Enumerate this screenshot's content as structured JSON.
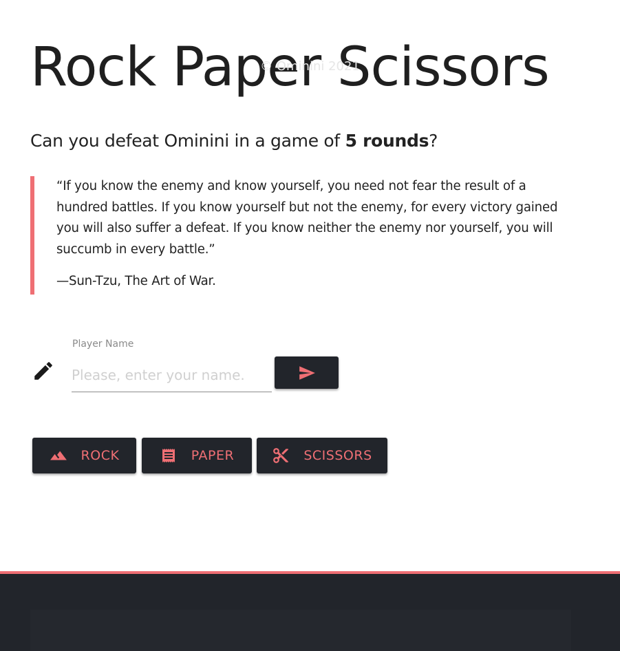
{
  "header": {
    "title": "Rock Paper Scissors",
    "subtitle_prefix": "Can you defeat Ominini in a game of ",
    "subtitle_bold": "5 rounds",
    "subtitle_suffix": "?"
  },
  "quote": {
    "text": "“If you know the enemy and know yourself, you need not fear the result of a hundred battles. If you know yourself but not the enemy, for every victory gained you will also suffer a defeat. If you know neither the enemy nor yourself, you will succumb in every battle.”",
    "author": "—Sun-Tzu, The Art of War."
  },
  "player": {
    "label": "Player Name",
    "placeholder": "Please, enter your name.",
    "value": ""
  },
  "choices": {
    "rock": "ROCK",
    "paper": "PAPER",
    "scissors": "SCISSORS"
  },
  "footer": {
    "copyright": "© Ominini 2021"
  },
  "icons": {
    "pencil": "pencil-icon",
    "send": "send-icon",
    "rock": "mountain-icon",
    "paper": "receipt-icon",
    "scissors": "scissors-icon"
  },
  "colors": {
    "accent": "#ef6f74",
    "dark": "#22252b",
    "text": "#222222"
  }
}
